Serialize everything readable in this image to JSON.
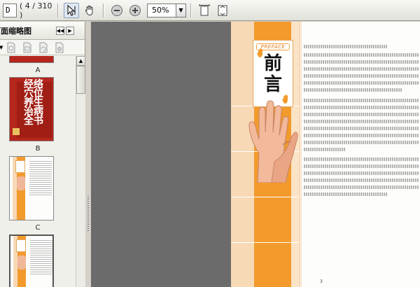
{
  "toolbar": {
    "current_page": "D",
    "page_count": "( 4 / 310 )",
    "zoom_value": "50%"
  },
  "sidebar": {
    "panel_title": "页面缩略图",
    "thumbnails": [
      {
        "label": "A"
      },
      {
        "label": "B",
        "cover_title": "经络穴位养生治病全书"
      },
      {
        "label": "C"
      },
      {
        "label": ""
      }
    ]
  },
  "page": {
    "preface_tag": "PREFACE",
    "title": "前言",
    "page_number": "3"
  },
  "colors": {
    "orange": "#f39a2c",
    "light_orange": "#f7d9b6",
    "cover_red": "#b5261c",
    "doc_bg": "#6b6b6b"
  }
}
